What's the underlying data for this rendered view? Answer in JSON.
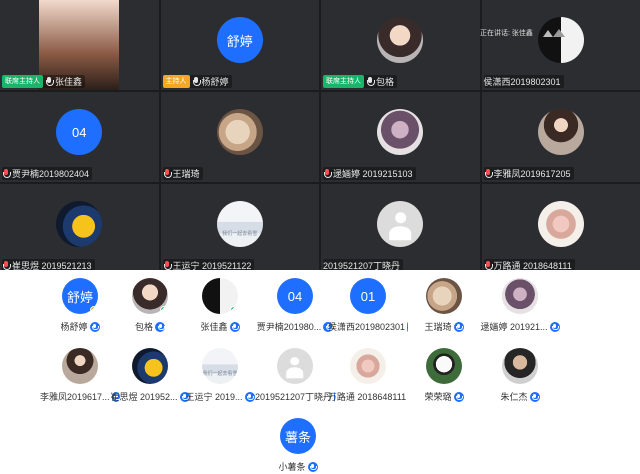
{
  "video_tiles": [
    {
      "name": "张佳鑫",
      "role": "联席主持人",
      "role_color": "#19b56b",
      "mic": "normal",
      "avatar": {
        "kind": "photo",
        "style": "ph-face"
      }
    },
    {
      "name": "杨舒婷",
      "role": "主持人",
      "role_color": "#f5a623",
      "mic": "normal",
      "avatar": {
        "kind": "text",
        "text": "舒婷"
      }
    },
    {
      "name": "包格",
      "role": "联席主持人",
      "role_color": "#19b56b",
      "mic": "normal",
      "avatar": {
        "kind": "photo",
        "style": "ph-girl"
      }
    },
    {
      "name": "侯潇西2019802301",
      "role": "",
      "mic": "none",
      "avatar": {
        "kind": "photo",
        "style": "ph-bw"
      }
    },
    {
      "name": "贾尹楠2019802404",
      "role": "",
      "mic": "red",
      "avatar": {
        "kind": "text",
        "text": "04"
      }
    },
    {
      "name": "王瑞琦",
      "role": "",
      "mic": "red",
      "avatar": {
        "kind": "photo",
        "style": "ph-cat"
      }
    },
    {
      "name": "逯婳婷 2019215103",
      "role": "",
      "mic": "red",
      "avatar": {
        "kind": "photo",
        "style": "ph-purple"
      }
    },
    {
      "name": "李雅凤2019617205",
      "role": "",
      "mic": "red",
      "avatar": {
        "kind": "photo",
        "style": "ph-gown"
      }
    },
    {
      "name": "崔思煜 2019521213",
      "role": "",
      "mic": "red",
      "avatar": {
        "kind": "photo",
        "style": "ph-yellow"
      }
    },
    {
      "name": "王运宁    2019521122",
      "role": "",
      "mic": "red",
      "avatar": {
        "kind": "photo",
        "style": "ph-snow"
      }
    },
    {
      "name": "2019521207丁晓丹",
      "role": "",
      "mic": "none",
      "avatar": {
        "kind": "silhouette"
      }
    },
    {
      "name": "万路通    2018648111",
      "role": "",
      "mic": "red",
      "avatar": {
        "kind": "photo",
        "style": "ph-group"
      }
    }
  ],
  "speaking_indicator": "正在讲话: 张佳鑫",
  "participants": [
    {
      "name": "杨舒婷",
      "avatar": {
        "kind": "text",
        "text": "舒婷"
      },
      "badge": "host"
    },
    {
      "name": "包格",
      "avatar": {
        "kind": "photo",
        "style": "ph-girl"
      },
      "badge": "cohost"
    },
    {
      "name": "张佳鑫",
      "avatar": {
        "kind": "photo",
        "style": "ph-bw"
      },
      "badge": "cohost"
    },
    {
      "name": "贾尹楠201980...",
      "avatar": {
        "kind": "text",
        "text": "04"
      },
      "badge": ""
    },
    {
      "name": "侯潇西2019802301",
      "avatar": {
        "kind": "text",
        "text": "01"
      },
      "badge": ""
    },
    {
      "name": "王瑞琦",
      "avatar": {
        "kind": "photo",
        "style": "ph-cat"
      },
      "badge": ""
    },
    {
      "name": "逯婳婷  201921...",
      "avatar": {
        "kind": "photo",
        "style": "ph-purple"
      },
      "badge": ""
    },
    {
      "name": "李雅凤2019617...",
      "avatar": {
        "kind": "photo",
        "style": "ph-gown"
      },
      "badge": ""
    },
    {
      "name": "崔思煜  201952...",
      "avatar": {
        "kind": "photo",
        "style": "ph-yellow"
      },
      "badge": ""
    },
    {
      "name": "王运宁     2019...",
      "avatar": {
        "kind": "photo",
        "style": "ph-snow"
      },
      "badge": ""
    },
    {
      "name": "2019521207丁晓丹",
      "avatar": {
        "kind": "silhouette"
      },
      "badge": ""
    },
    {
      "name": "万路通    2018648111",
      "avatar": {
        "kind": "photo",
        "style": "ph-group"
      },
      "badge": ""
    },
    {
      "name": "荣荣璐",
      "avatar": {
        "kind": "photo",
        "style": "ph-panda"
      },
      "badge": ""
    },
    {
      "name": "朱仁杰",
      "avatar": {
        "kind": "photo",
        "style": "ph-man"
      },
      "badge": ""
    },
    {
      "name": "小薯条",
      "avatar": {
        "kind": "text",
        "text": "薯条"
      },
      "badge": ""
    }
  ],
  "snow_text": "我们一起去看雪"
}
